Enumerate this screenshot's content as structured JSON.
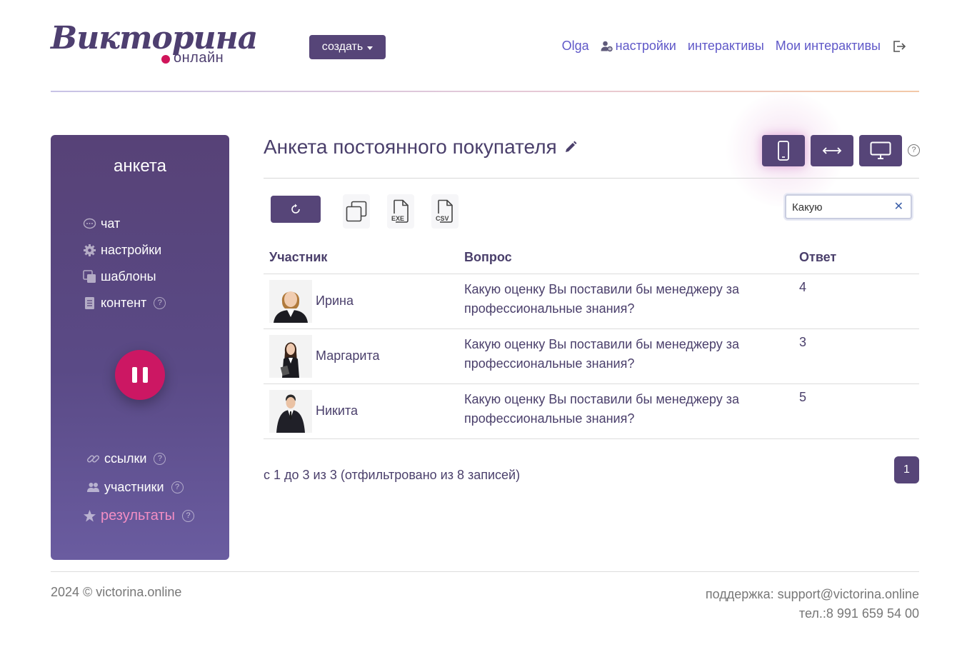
{
  "logo": {
    "main": "Викторина",
    "sub": "онлайн"
  },
  "header": {
    "create_label": "создать",
    "nav": {
      "user": "Olga",
      "settings": "настройки",
      "interactives": "интерактивы",
      "my_interactives": "Мои интерактивы"
    }
  },
  "sidebar": {
    "title": "анкета",
    "items": [
      {
        "label": "чат",
        "icon": "chat-icon"
      },
      {
        "label": "настройки",
        "icon": "gear-icon"
      },
      {
        "label": "шаблоны",
        "icon": "templates-icon"
      },
      {
        "label": "контент",
        "icon": "document-icon",
        "help": "?"
      }
    ],
    "bottom_items": [
      {
        "label": "ссылки",
        "icon": "link-icon",
        "help": "?"
      },
      {
        "label": "участники",
        "icon": "users-icon",
        "help": "?"
      },
      {
        "label": "результаты",
        "icon": "star-icon",
        "help": "?"
      }
    ]
  },
  "main": {
    "title": "Анкета постоянного покупателя",
    "help": "?",
    "toolbar": {
      "exe_label": "EXE",
      "csv_label": "CSV"
    },
    "search": {
      "value": "Какую"
    },
    "table": {
      "headers": [
        "Участник",
        "Вопрос",
        "Ответ"
      ],
      "rows": [
        {
          "name": "Ирина",
          "question": "Какую оценку Вы поставили бы менеджеру за профессиональные знания?",
          "answer": "4"
        },
        {
          "name": "Маргарита",
          "question": "Какую оценку Вы поставили бы менеджеру за профессиональные знания?",
          "answer": "3"
        },
        {
          "name": "Никита",
          "question": "Какую оценку Вы поставили бы менеджеру за профессиональные знания?",
          "answer": "5"
        }
      ]
    },
    "pager": {
      "info": "с 1 до 3 из 3 (отфильтровано из 8 записей)",
      "page": "1"
    }
  },
  "footer": {
    "copyright": "2024 © victorina.online",
    "support": "поддержка: support@victorina.online",
    "phone": "тел.:8 991 659 54 00"
  },
  "colors": {
    "primary": "#564578",
    "accent": "#cc1763",
    "link": "#5f58c8",
    "active": "#f28ec4"
  }
}
